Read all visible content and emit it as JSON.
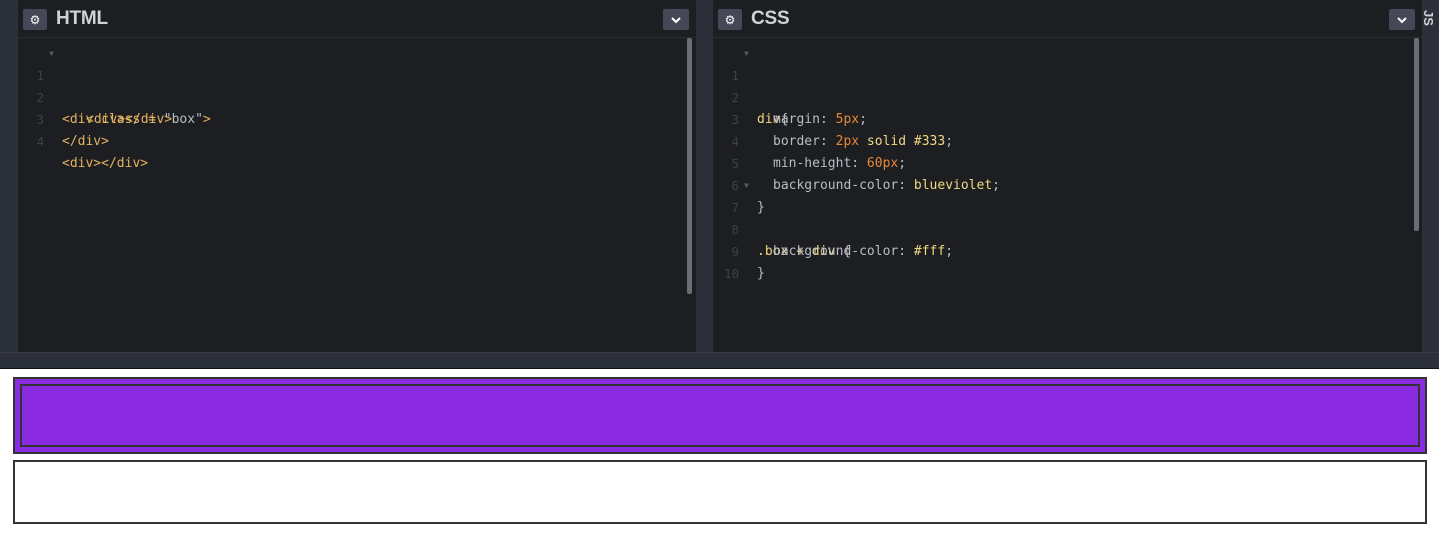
{
  "html_panel": {
    "title": "HTML",
    "settings_icon": "gear-icon",
    "collapse_icon": "chevron-down-icon",
    "lines": [
      {
        "n": "1",
        "fold": true
      },
      {
        "n": "2",
        "fold": false
      },
      {
        "n": "3",
        "fold": false
      },
      {
        "n": "4",
        "fold": false
      }
    ],
    "code": {
      "l1_open": "<div",
      "l1_attr": " class = ",
      "l1_str": "\"box\"",
      "l1_close": ">",
      "l2": "<div></div>",
      "l3": "</div>",
      "l4": "<div></div>"
    }
  },
  "css_panel": {
    "title": "CSS",
    "settings_icon": "gear-icon",
    "collapse_icon": "chevron-down-icon",
    "line_numbers": [
      "1",
      "2",
      "3",
      "4",
      "5",
      "6",
      "7",
      "8",
      "9",
      "10"
    ],
    "code": {
      "l1_sel": "div",
      "l1_brace": "{",
      "l2_prop": "margin: ",
      "l2_val": "5px",
      "l2_end": ";",
      "l3_prop": "border: ",
      "l3_num": "2px",
      "l3_val": " solid #333",
      "l3_end": ";",
      "l4_prop": "min-height: ",
      "l4_val": "60px",
      "l4_end": ";",
      "l5_prop": "background-color: ",
      "l5_val": "blueviolet",
      "l5_end": ";",
      "l6": "}",
      "l7_sel": ".box + div ",
      "l7_brace": "{",
      "l8_prop": "background-color: ",
      "l8_val": "#fff",
      "l8_end": ";",
      "l9": "}"
    }
  },
  "js_panel": {
    "title": "JS"
  },
  "colors": {
    "editor_bg": "#1d1e22",
    "strip_bg": "#2c303a",
    "box_bg": "#8a2be2",
    "border": "#333333"
  }
}
